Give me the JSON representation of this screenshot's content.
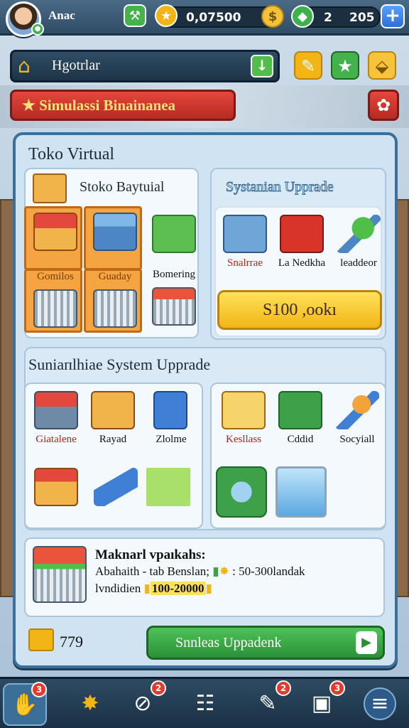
{
  "topbar": {
    "player_name": "Anac",
    "currency_value": "0,07500",
    "resource_a": "2",
    "resource_b": "205"
  },
  "location": {
    "label": "Hgotrlar"
  },
  "banner": {
    "label": "Simulassi Binainanea"
  },
  "panel": {
    "title": "Toko Virtual",
    "store_card": {
      "title": "Stoko Baytuial",
      "items": [
        {
          "label": ""
        },
        {
          "label": ""
        },
        {
          "label": ""
        },
        {
          "label": "Gomilos"
        },
        {
          "label": "Guaday"
        },
        {
          "label": "Bomering"
        }
      ]
    },
    "system_card": {
      "title": "Systanian Upprade",
      "items": [
        {
          "label": "Snalrrae"
        },
        {
          "label": "La Nedkha"
        },
        {
          "label": "leaddeor"
        }
      ],
      "price": "S100 ,ookı"
    },
    "section2_title": "Suniaпlhiae System Upprade",
    "left_card": {
      "items": [
        {
          "label": "Giatalene"
        },
        {
          "label": "Rayad"
        },
        {
          "label": "Zlolme"
        },
        {
          "label": ""
        },
        {
          "label": ""
        },
        {
          "label": ""
        }
      ]
    },
    "right_card": {
      "items": [
        {
          "label": "Kesllass"
        },
        {
          "label": "Cddid"
        },
        {
          "label": "Socyiall"
        },
        {
          "label": ""
        },
        {
          "label": ""
        }
      ]
    },
    "info": {
      "title": "Maknarl vpaıkahs:",
      "line1_a": "Abahaith - tab Benslan;",
      "line1_b": ": 50-300landak",
      "line2_a": "lvndidien",
      "line2_b": "100-20000"
    },
    "gold_count": "779",
    "upgrade_button": "Snnleas Uppadenk"
  },
  "bottomnav": {
    "badges": [
      "3",
      "2",
      "2",
      "3"
    ]
  },
  "colors": {
    "accent_green": "#2a9036",
    "accent_yellow": "#f2b515",
    "accent_red": "#b52a22",
    "frame_blue": "#3b6f97"
  }
}
